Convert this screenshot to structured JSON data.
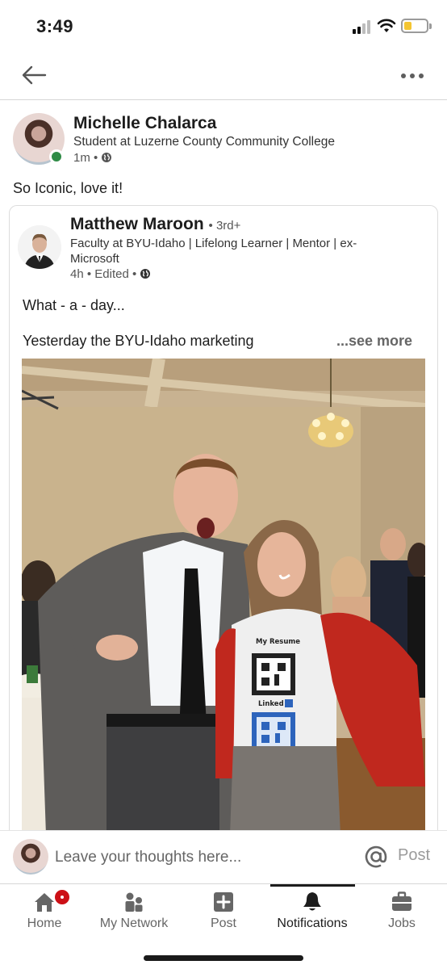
{
  "status_bar": {
    "time": "3:49"
  },
  "commenter": {
    "name": "Michelle Chalarca",
    "headline": "Student at Luzerne County Community College",
    "timestamp": "1m",
    "comment": "So Iconic, love it!"
  },
  "post": {
    "author_name": "Matthew Maroon",
    "degree": "3rd+",
    "headline": "Faculty at BYU-Idaho | Lifelong Learner | Mentor | ex-Microsoft",
    "time": "4h",
    "edited": "Edited",
    "line1": "What - a - day...",
    "line2": "Yesterday the BYU-Idaho marketing",
    "see_more": "...see more",
    "shirt_text_top": "My Resume",
    "shirt_text_bottom": "Linked"
  },
  "comment_bar": {
    "placeholder": "Leave your thoughts here...",
    "post_label": "Post"
  },
  "tabs": [
    {
      "label": "Home",
      "icon": "home-icon"
    },
    {
      "label": "My Network",
      "icon": "network-icon"
    },
    {
      "label": "Post",
      "icon": "post-plus-icon"
    },
    {
      "label": "Notifications",
      "icon": "bell-icon",
      "active": true
    },
    {
      "label": "Jobs",
      "icon": "briefcase-icon"
    }
  ],
  "colors": {
    "online": "#2f8b46",
    "badge": "#cc1016",
    "battery": "#f4c531",
    "link_gray": "#666666"
  }
}
